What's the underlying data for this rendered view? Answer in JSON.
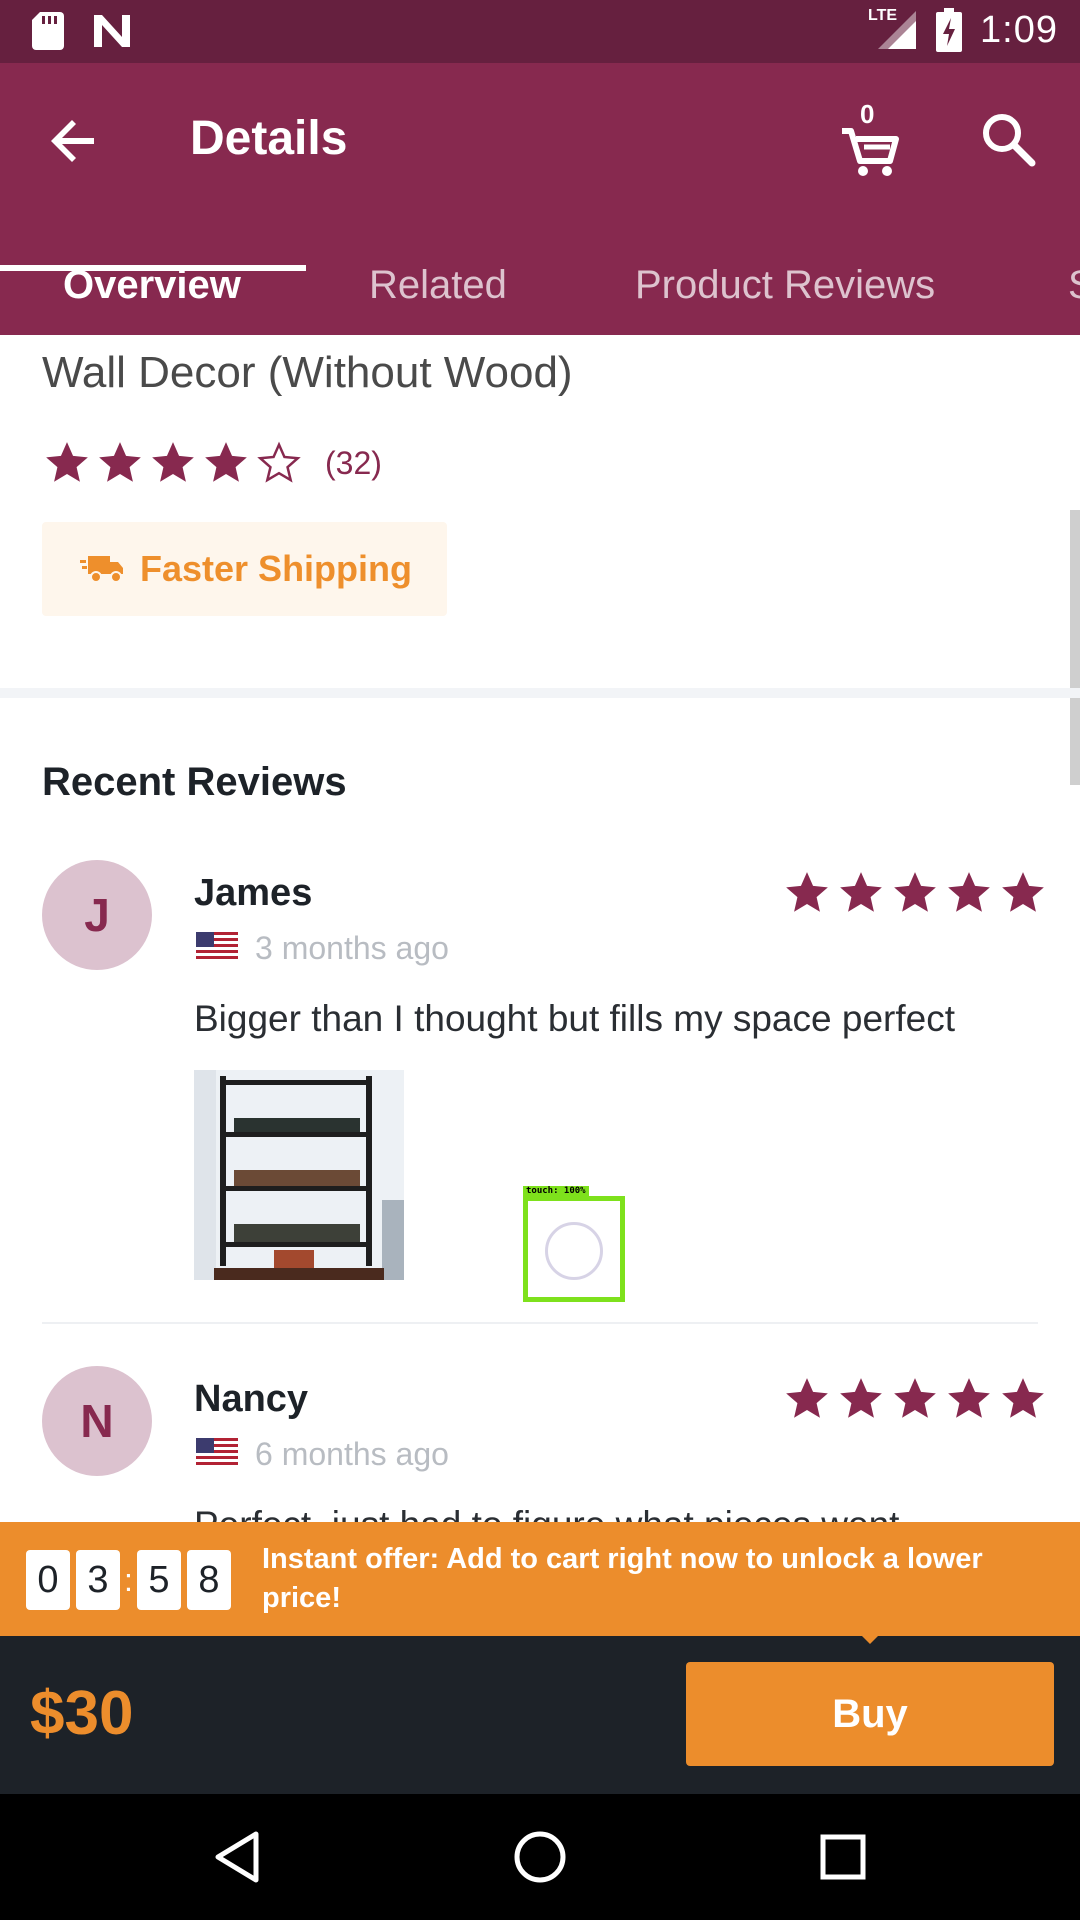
{
  "status_bar": {
    "network": "LTE",
    "time": "1:09"
  },
  "header": {
    "title": "Details",
    "cart_count": "0",
    "tabs": [
      "Overview",
      "Related",
      "Product Reviews",
      "S"
    ]
  },
  "product": {
    "name_line": "Wall Decor (Without Wood)",
    "rating": 4,
    "rating_max": 5,
    "rating_count": "(32)",
    "shipping_label": "Faster Shipping"
  },
  "reviews": {
    "heading": "Recent Reviews",
    "items": [
      {
        "initial": "J",
        "name": "James",
        "date": "3 months ago",
        "stars": 5,
        "text": "Bigger than I thought but fills my space perfect"
      },
      {
        "initial": "N",
        "name": "Nancy",
        "date": "6 months ago",
        "stars": 5,
        "text": "Perfect, just had to figure what pieces went"
      }
    ]
  },
  "touch_overlay": {
    "label": "touch: 100%"
  },
  "offer": {
    "timer_digits": [
      "0",
      "3",
      "5",
      "8"
    ],
    "text": "Instant offer: Add to cart right now to unlock a lower price!"
  },
  "purchase": {
    "price": "$30",
    "buy_label": "Buy"
  },
  "colors": {
    "brand": "#87294f",
    "status_bar": "#66203f",
    "accent": "#ec8d2c",
    "dark": "#1d2228"
  }
}
